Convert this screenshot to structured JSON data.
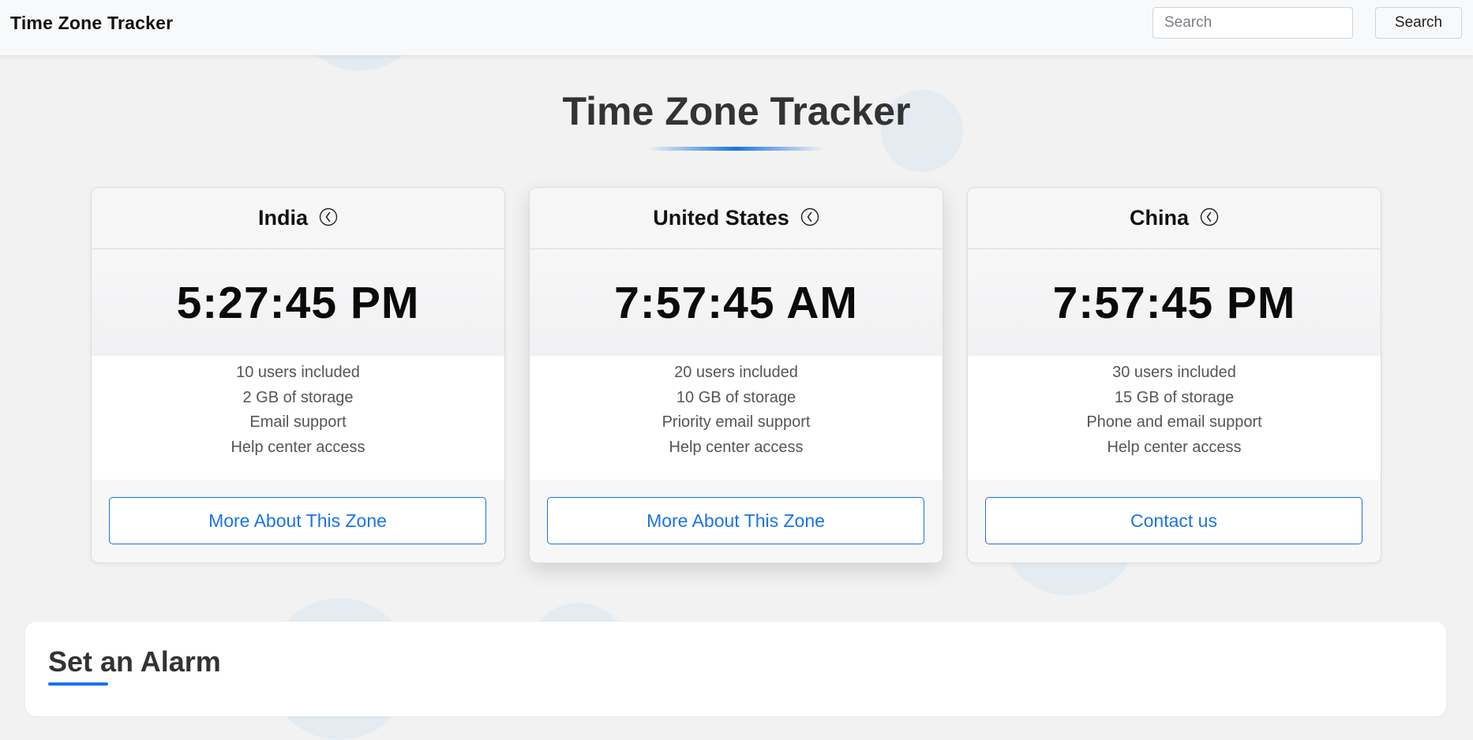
{
  "navbar": {
    "brand": "Time Zone Tracker",
    "search_placeholder": "Search",
    "search_button": "Search"
  },
  "page": {
    "title": "Time Zone Tracker"
  },
  "cards": [
    {
      "country": "India",
      "icon": "clock-icon",
      "time": "5:27:45 PM",
      "features": [
        "10 users included",
        "2 GB of storage",
        "Email support",
        "Help center access"
      ],
      "button": "More About This Zone"
    },
    {
      "country": "United States",
      "icon": "clock-icon",
      "time": "7:57:45 AM",
      "features": [
        "20 users included",
        "10 GB of storage",
        "Priority email support",
        "Help center access"
      ],
      "button": "More About This Zone"
    },
    {
      "country": "China",
      "icon": "clock-icon",
      "time": "7:57:45 PM",
      "features": [
        "30 users included",
        "15 GB of storage",
        "Phone and email support",
        "Help center access"
      ],
      "button": "Contact us"
    }
  ],
  "alarm": {
    "title": "Set an Alarm"
  },
  "colors": {
    "accent": "#1a73e8",
    "background": "#f2f2f3",
    "navbar": "#f8f9fa"
  }
}
